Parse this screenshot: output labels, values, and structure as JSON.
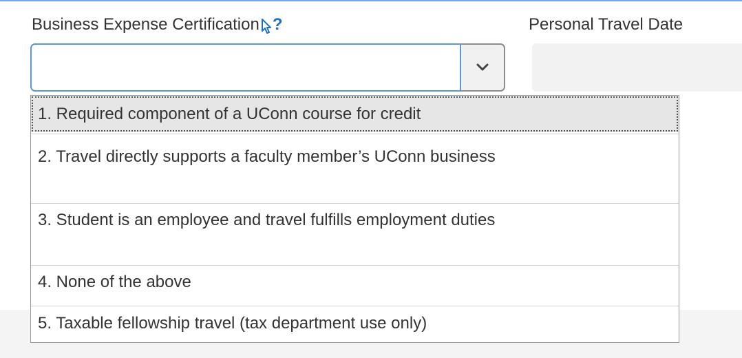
{
  "form": {
    "certification_label": "Business Expense Certification",
    "help_icon_text": "?",
    "travel_label": "Personal Travel Date",
    "certification_value": "",
    "travel_value": ""
  },
  "dropdown": {
    "options": [
      "1. Required component of a UConn course for credit",
      "2. Travel directly supports a faculty member’s UConn business",
      "3. Student is an employee and travel fulfills employment duties",
      "4. None of the above",
      "5. Taxable fellowship travel (tax department use only)"
    ],
    "highlighted_index": 0
  },
  "colors": {
    "focus_border": "#5b96d6",
    "help_icon": "#1d6fc6",
    "highlight_bg": "#e6e6e6"
  },
  "icons": {
    "select_toggle": "chevron-down-icon",
    "cursor": "mouse-cursor-icon",
    "help": "question-mark-icon"
  }
}
